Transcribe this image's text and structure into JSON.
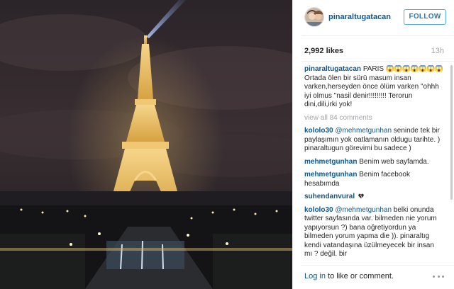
{
  "header": {
    "username": "pinaraltugatacan",
    "follow_label": "FOLLOW"
  },
  "stats": {
    "likes": "2,992 likes",
    "time": "13h"
  },
  "caption": {
    "user": "pinaraltugatacan",
    "text_title": "PARIS",
    "emoji": "😱😱😱😱😱😱😱",
    "text_body": " Ortada ölen bir sürü masum insan varken,herseyden önce ölüm varken \"ohhh iyi olmus \"nasil denir!!!!!!!!! Terorun dini,dili,irki yok!"
  },
  "view_all": "view all 84 comments",
  "comments": [
    {
      "user": "kololo30",
      "mention": "@mehmetgunhan",
      "text": " seninde tek bir paylaşımın yok oatlamanın oldugu tarihte. ) pinaraltugun görevimi bu sadece )"
    },
    {
      "user": "mehmetgunhan",
      "mention": "",
      "text": " Benim web sayfamda."
    },
    {
      "user": "mehmetgunhan",
      "mention": "",
      "text": " Benim facebook hesabımda"
    },
    {
      "user": "suhendanvural",
      "mention": "",
      "text": " "
    },
    {
      "user": "kololo30",
      "mention": "@mehmetgunhan",
      "text": " belki onunda twitter sayfasında var. bilmeden nie yorum yapıyorsun ?) bana oğretiyordun ya bilmeden yorum yapma die )). pinaraltıg kendi vatandaşına üzülmeyecek bir insan mı ? değil. bir"
    }
  ],
  "footer": {
    "login_link": "Log in",
    "rest": " to like or comment."
  },
  "colors": {
    "username": "#125688",
    "follow_border": "#4bacdc",
    "muted": "#a5a7aa"
  },
  "icons": {
    "more": "more-options-icon",
    "heart": "broken-heart-icon"
  }
}
